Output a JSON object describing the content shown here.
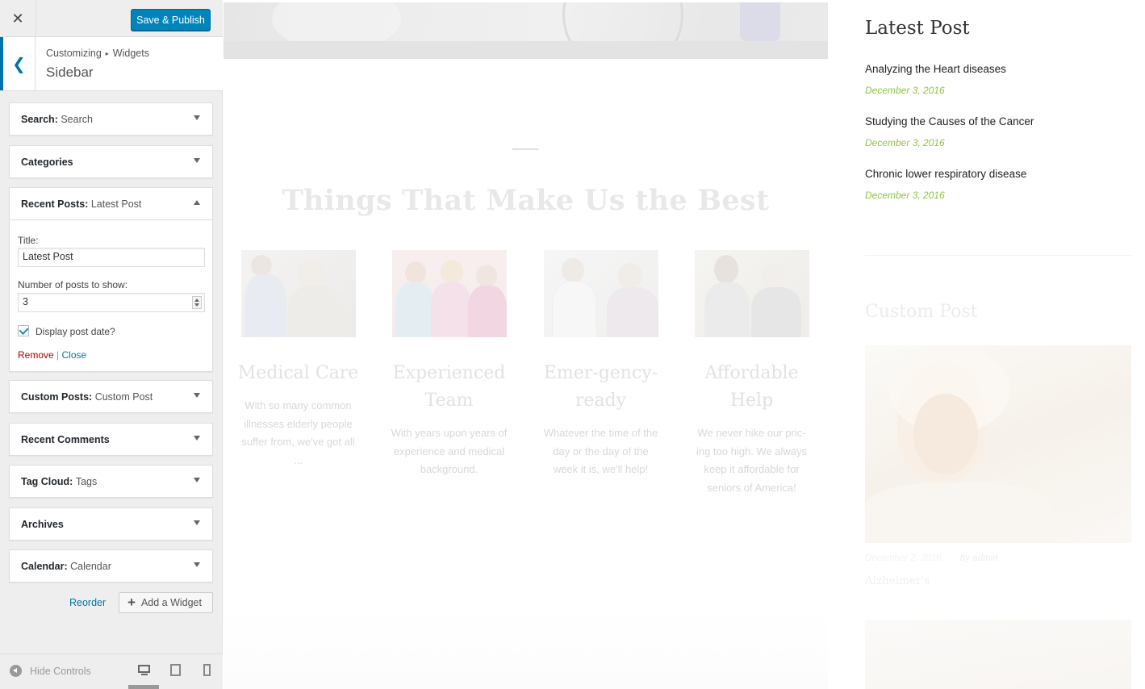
{
  "customizer": {
    "close_icon": "✕",
    "save_button": "Save & Publish",
    "breadcrumb": [
      "Customizing",
      "Widgets"
    ],
    "breadcrumb_separator": "▸",
    "section_title": "Sidebar",
    "widgets": [
      {
        "name": "Search:",
        "instance": "Search",
        "expanded": false
      },
      {
        "name": "Categories",
        "instance": "",
        "expanded": false
      },
      {
        "name": "Recent Posts:",
        "instance": "Latest Post",
        "expanded": true
      },
      {
        "name": "Custom Posts:",
        "instance": "Custom Post",
        "expanded": false
      },
      {
        "name": "Recent Comments",
        "instance": "",
        "expanded": false
      },
      {
        "name": "Tag Cloud:",
        "instance": "Tags",
        "expanded": false
      },
      {
        "name": "Archives",
        "instance": "",
        "expanded": false
      },
      {
        "name": "Calendar:",
        "instance": "Calendar",
        "expanded": false
      }
    ],
    "recent_posts_form": {
      "title_label": "Title:",
      "title_value": "Latest Post",
      "number_label": "Number of posts to show:",
      "number_value": "3",
      "display_date_label": "Display post date?",
      "display_date_checked": true,
      "remove_label": "Remove",
      "separator": "|",
      "close_label": "Close"
    },
    "reorder_label": "Reorder",
    "add_widget_label": "Add a Widget",
    "hide_controls_label": "Hide Controls",
    "devices": [
      "desktop-icon",
      "tablet-icon",
      "mobile-icon"
    ],
    "accent_color": "#0085ba"
  },
  "preview": {
    "section_heading": "Things That Make Us the Best",
    "features": [
      {
        "title": "Medical Care",
        "text": "With so many common illnesses elderly people suffer from, we've got all ..."
      },
      {
        "title": "Experienced Team",
        "text": "With years upon years of experience and medical background."
      },
      {
        "title": "Emer-gency-ready",
        "text": "Whatever the time of the day or the day of the week it is, we'll help!"
      },
      {
        "title": "Affordable Help",
        "text": "We never hike our pric-ing too high. We always keep it affordable for seniors of America!"
      }
    ],
    "latest_post": {
      "heading": "Latest Post",
      "posts": [
        {
          "title": "Analyzing the Heart diseases",
          "date": "December 3, 2016"
        },
        {
          "title": "Studying the Causes of the Cancer",
          "date": "December 3, 2016"
        },
        {
          "title": "Chronic lower respiratory disease",
          "date": "December 3, 2016"
        }
      ]
    },
    "custom_post": {
      "heading": "Custom Post",
      "date": "December 2, 2016",
      "author": "by admin",
      "title": "Alzheimer's"
    },
    "date_color": "#8dc63f"
  }
}
